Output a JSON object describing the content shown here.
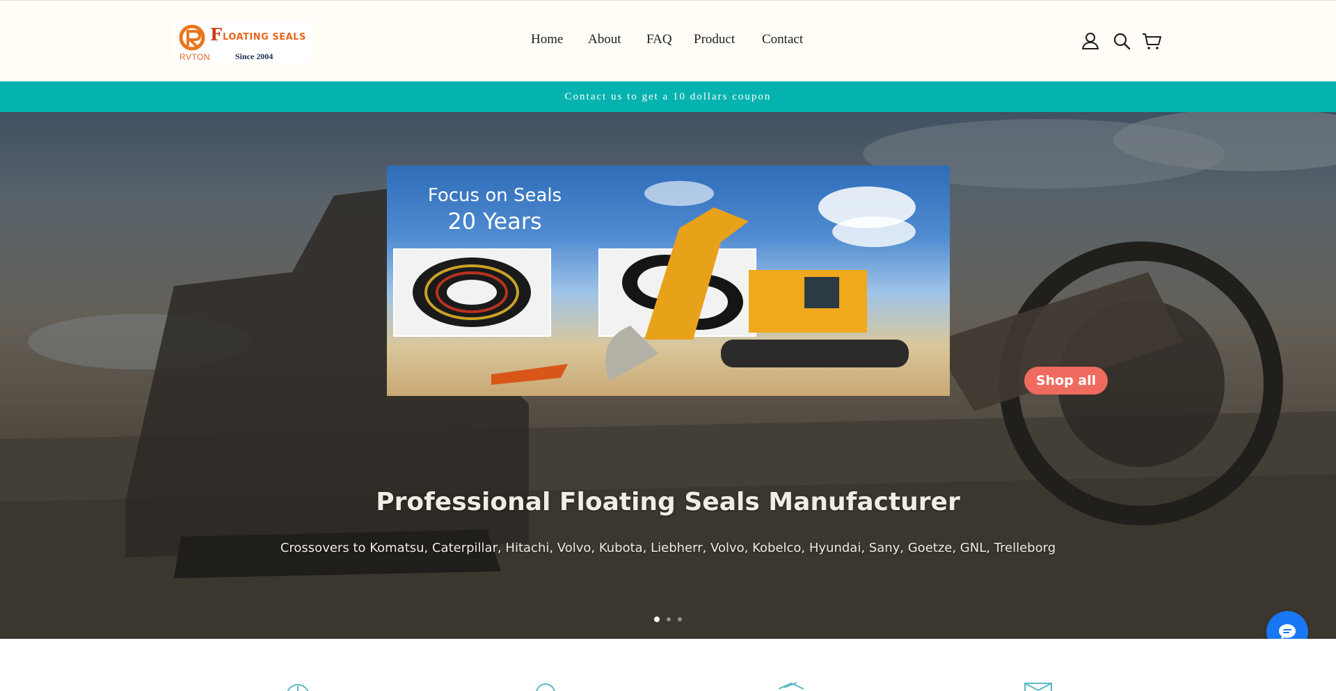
{
  "header": {
    "logo": {
      "mark_letter": "F",
      "text": "LOATING SEALS",
      "brand": "RVTON",
      "since": "Since 2004"
    },
    "nav": [
      {
        "label": "Home"
      },
      {
        "label": "About"
      },
      {
        "label": "FAQ"
      },
      {
        "label": "Product"
      },
      {
        "label": "Contact"
      }
    ],
    "icons": [
      "account-icon",
      "search-icon",
      "cart-icon"
    ]
  },
  "announcement": {
    "text": "Contact us to get a 10 dollars coupon",
    "background": "#04b3af"
  },
  "hero": {
    "promo": {
      "line1": "Focus on Seals",
      "line2": "20 Years"
    },
    "button_label": "Shop all",
    "button_color": "#ef6a5f",
    "title": "Professional Floating Seals Manufacturer",
    "subtitle": "Crossovers to Komatsu, Caterpillar, Hitachi, Volvo, Kubota, Liebherr, Volvo, Kobelco, Hyundai, Sany, Goetze, GNL, Trelleborg",
    "slides": {
      "count": 3,
      "active_index": 0
    }
  },
  "chat": {
    "icon": "chat-bubble-icon",
    "color": "#1877f2"
  },
  "features": {
    "icons": [
      "info-icon",
      "location-icon",
      "box-icon",
      "mail-icon"
    ],
    "color": "#5bb8c4"
  }
}
